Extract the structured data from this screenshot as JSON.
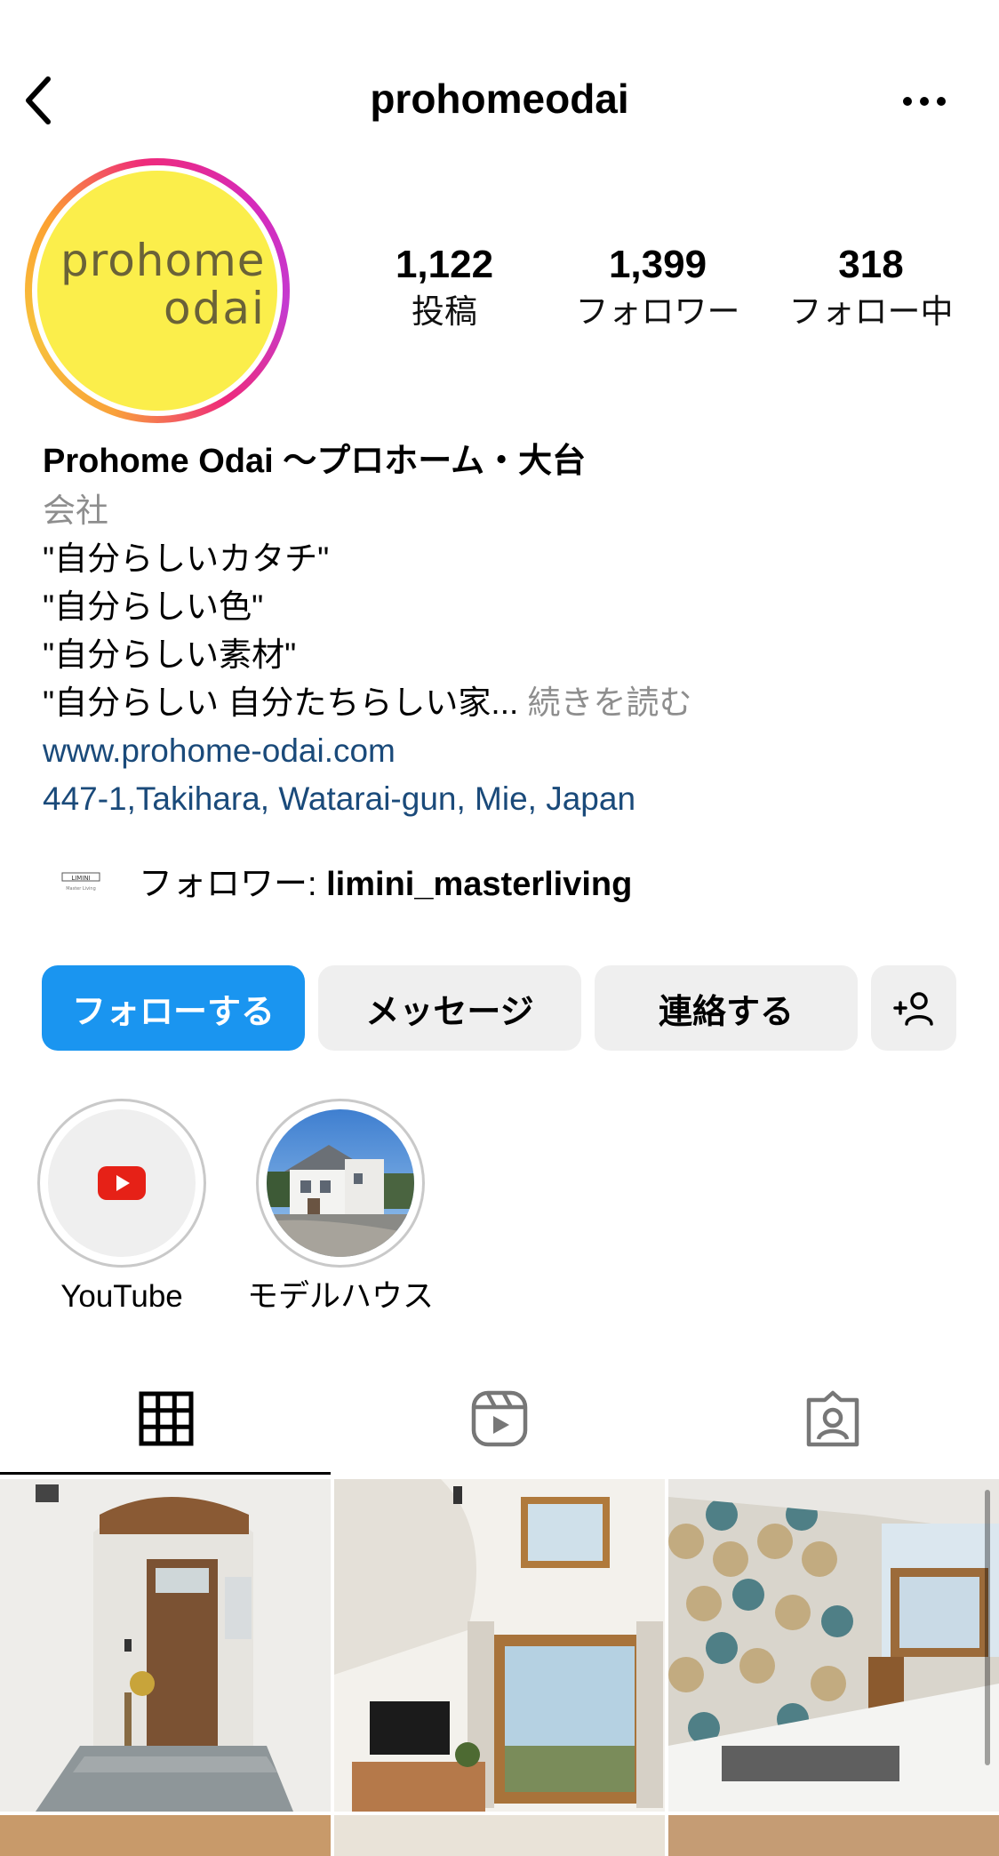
{
  "header": {
    "username": "prohomeodai",
    "back_icon": "chevron-left-icon",
    "more_icon": "more-horizontal-icon"
  },
  "avatar": {
    "logo_line1": "prohome",
    "logo_line2": "odai",
    "bg_color": "#fbee4b"
  },
  "stats": {
    "posts": {
      "value": "1,122",
      "label": "投稿"
    },
    "followers": {
      "value": "1,399",
      "label": "フォロワー"
    },
    "following": {
      "value": "318",
      "label": "フォロー中"
    }
  },
  "bio": {
    "name": "Prohome Odai 〜プロホーム・大台",
    "category": "会社",
    "lines": [
      "\"自分らしいカタチ\"",
      "\"自分らしい色\"",
      "\"自分らしい素材\"",
      "\"自分らしい 自分たちらしい家..."
    ],
    "more": "続きを読む",
    "website": "www.prohome-odai.com",
    "address": "447-1,Takihara, Watarai-gun, Mie, Japan"
  },
  "followed_by": {
    "prefix": "フォロワー: ",
    "username": "limini_masterliving",
    "avatar_text": "LIMINI",
    "avatar_subtext": "Master Living"
  },
  "buttons": {
    "follow": "フォローする",
    "message": "メッセージ",
    "contact": "連絡する",
    "add_user_icon": "add-person-icon",
    "primary_color": "#1a95f0"
  },
  "highlights": [
    {
      "label": "YouTube",
      "icon": "youtube-icon"
    },
    {
      "label": "モデルハウス",
      "icon": "house-photo"
    }
  ],
  "tabs": [
    {
      "name": "posts",
      "icon": "grid-icon",
      "active": true
    },
    {
      "name": "reels",
      "icon": "reels-icon",
      "active": false
    },
    {
      "name": "tagged",
      "icon": "tagged-person-icon",
      "active": false
    }
  ],
  "grid": [
    {
      "subject": "entrance-door-photo"
    },
    {
      "subject": "living-room-photo"
    },
    {
      "subject": "kitchen-tiles-photo"
    }
  ]
}
